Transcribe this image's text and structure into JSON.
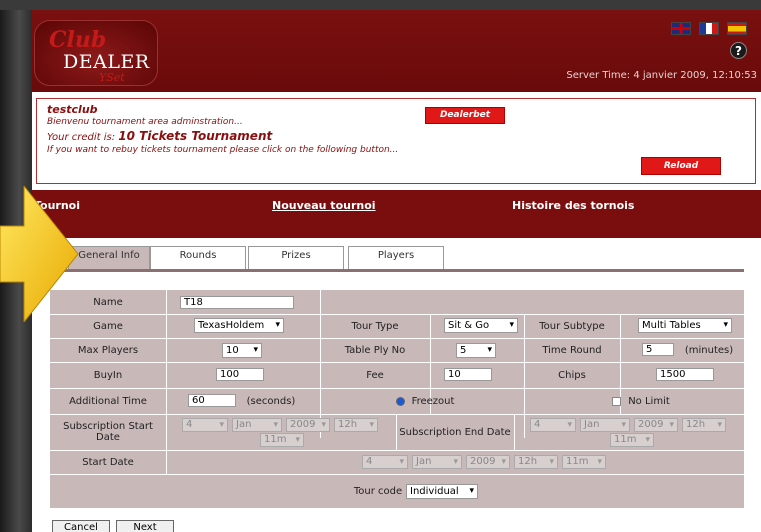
{
  "header": {
    "logo_club": "Club",
    "logo_dealer": "DEALER",
    "logo_yset": "YSet",
    "help": "?",
    "server_time": "Server Time: 4 janvier 2009, 12:10:53"
  },
  "info": {
    "club_name": "testclub",
    "welcome": "Bienvenu tournament area adminstration...",
    "credit_prefix": "Your credit is: ",
    "credit_value": "10 Tickets Tournament",
    "rebuy": "If you want to rebuy tickets tournament please click on the following button...",
    "dealerbet_label": "Dealerbet",
    "reload_label": "Reload"
  },
  "nav": {
    "tournoi": "Tournoi",
    "nouveau": "Nouveau tournoi",
    "histoire": "Histoire des tornois"
  },
  "tabs": [
    "General Info",
    "Rounds",
    "Prizes",
    "Players"
  ],
  "form": {
    "name_label": "Name",
    "name_value": "T18",
    "game_label": "Game",
    "game_value": "TexasHoldem",
    "tour_type_label": "Tour Type",
    "tour_type_value": "Sit & Go",
    "tour_subtype_label": "Tour Subtype",
    "tour_subtype_value": "Multi Tables",
    "max_players_label": "Max Players",
    "max_players_value": "10",
    "table_ply_label": "Table Ply No",
    "table_ply_value": "5",
    "time_round_label": "Time Round",
    "time_round_value": "5",
    "time_round_unit": "(minutes)",
    "buyin_label": "BuyIn",
    "buyin_value": "100",
    "fee_label": "Fee",
    "fee_value": "10",
    "chips_label": "Chips",
    "chips_value": "1500",
    "additional_time_label": "Additional Time",
    "additional_time_value": "60",
    "additional_time_unit": "(seconds)",
    "freezout_label": "Freezout",
    "no_limit_label": "No Limit",
    "sub_start_label": "Subscription Start Date",
    "sub_end_label": "Subscription End Date",
    "start_date_label": "Start Date",
    "date_day": "4",
    "date_month": "Jan",
    "date_year": "2009",
    "date_hour": "12h",
    "date_min": "11m",
    "tour_code_label": "Tour code",
    "tour_code_value": "Individual"
  },
  "buttons": {
    "cancel": "Cancel",
    "next": "Next"
  },
  "colors": {
    "brand_dark_red": "#7a0e0e",
    "button_red": "#e01818",
    "form_bg": "#c8b8b8",
    "arrow_yellow": "#f5c400"
  }
}
